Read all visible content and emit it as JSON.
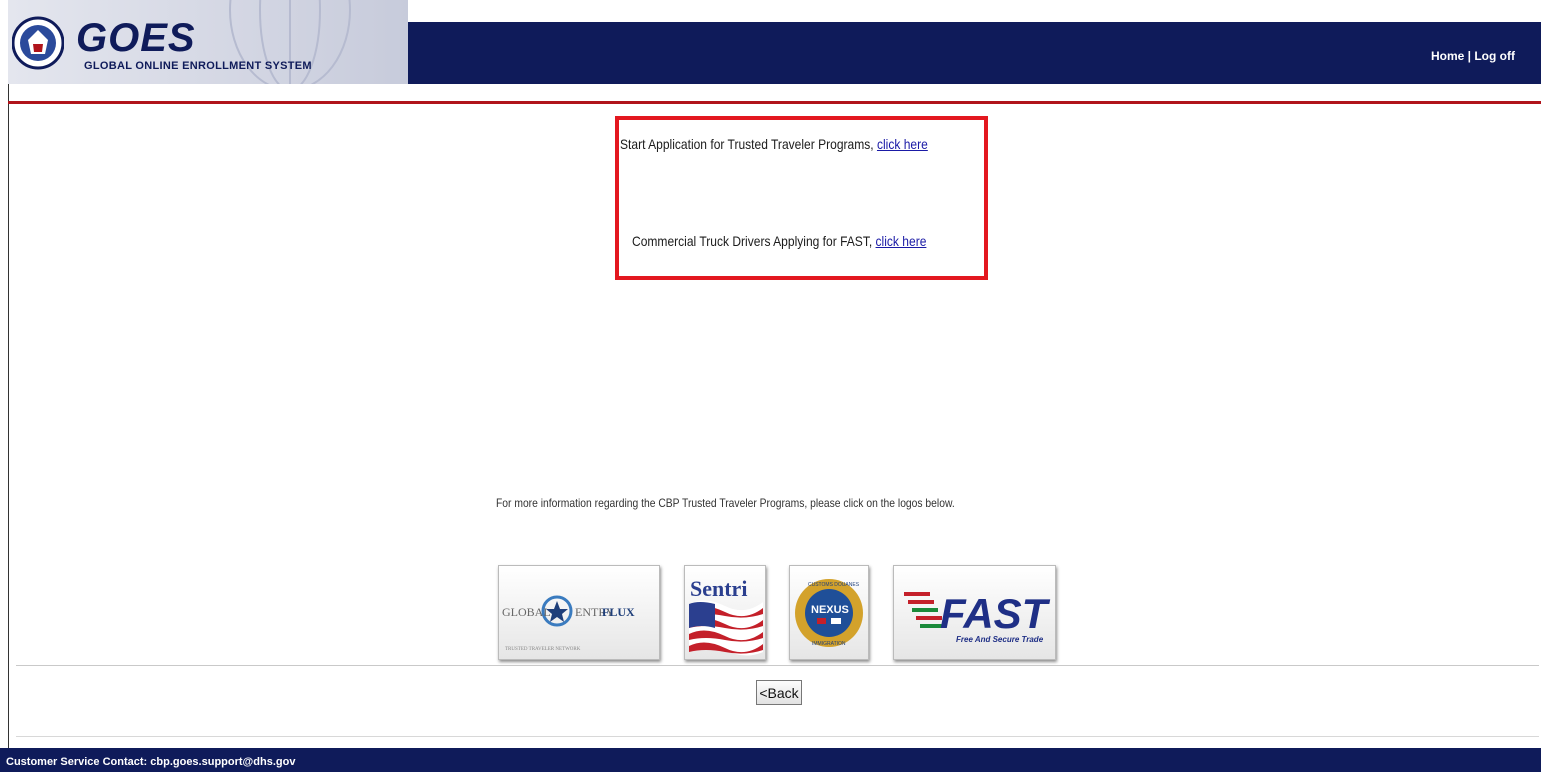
{
  "header": {
    "brand_title": "GOES",
    "brand_subtitle": "GLOBAL ONLINE ENROLLMENT SYSTEM",
    "nav": {
      "home": "Home",
      "separator": "|",
      "logoff": "Log off"
    }
  },
  "main": {
    "start_text": "Start Application for Trusted Traveler Programs,",
    "start_link": "click here",
    "fast_text": "Commercial Truck Drivers Applying for FAST,",
    "fast_link": "click here",
    "info_text": "For more information regarding the CBP Trusted Traveler Programs, please click on the logos below."
  },
  "logos": {
    "global_entry": {
      "left": "GLOBAL",
      "mid": "ENTRY",
      "right": "FLUX",
      "sub": "TRUSTED TRAVELER NETWORK"
    },
    "sentri": {
      "text": "Sentri"
    },
    "nexus": {
      "text": "NEXUS",
      "top": "CUSTOMS DOUANES",
      "bottom": "IMMIGRATION"
    },
    "fast": {
      "text": "FAST",
      "sub": "Free And Secure Trade"
    }
  },
  "back_button": "<Back",
  "footer": {
    "contact": "Customer Service Contact: cbp.goes.support@dhs.gov"
  },
  "colors": {
    "navy": "#0f1b5a",
    "red": "#e3181f",
    "link": "#1a1aa6"
  }
}
